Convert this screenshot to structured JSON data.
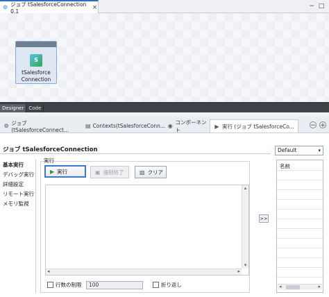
{
  "editor": {
    "tab_title": "ジョブ tSalesforceConnection 0.1",
    "close_icon": "×",
    "minimize_icon": "−",
    "maximize_icon": "□"
  },
  "canvas": {
    "component_label": "tSalesforce Connection",
    "component_icon": "S"
  },
  "designer_tabs": [
    "Designer",
    "Code"
  ],
  "view_tabs": [
    {
      "label": "ジョブ(tSalesforceConnect...",
      "icon": "job-icon"
    },
    {
      "label": "Contexts(tSalesforceConn...",
      "icon": "contexts-icon"
    },
    {
      "label": "コンポーネント",
      "icon": "component-icon"
    },
    {
      "label": "実行 (ジョブ tSalesforceCo...",
      "icon": "run-icon"
    }
  ],
  "view_controls": {
    "min": "−",
    "max": "+"
  },
  "run_panel": {
    "title": "ジョブ tSalesforceConnection",
    "menu": [
      "基本実行",
      "デバッグ実行",
      "詳細設定",
      "リモート実行",
      "メモリ監視"
    ],
    "group_label": "実行",
    "buttons": {
      "run": "実行",
      "kill": "強制終了",
      "clear": "クリア"
    },
    "limit_lines_label": "行数の制限",
    "limit_value": "100",
    "wrap_label": "折り返し",
    "move_button": ">>"
  },
  "context": {
    "selected": "Default",
    "column_header": "名前"
  }
}
